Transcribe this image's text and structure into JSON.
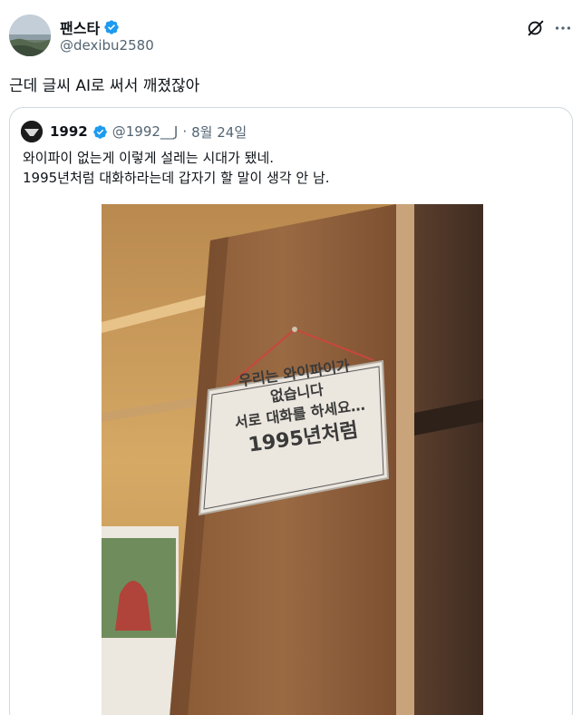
{
  "tweet": {
    "display_name": "팬스타",
    "handle": "@dexibu2580",
    "text": "근데 글씨 AI로 써서 깨졌잖아",
    "icons": {
      "verified": "verified-badge-icon",
      "grok": "grok-icon",
      "more": "more-icon"
    }
  },
  "quote": {
    "display_name": "1992",
    "handle": "@1992__J",
    "separator": "·",
    "date": "8월 24일",
    "line1": "와이파이 없는게 이렇게 설레는 시대가 됐네.",
    "line2": "1995년처럼 대화하라는데 갑자기 할 말이 생각 안 남."
  },
  "photo_sign": {
    "line1": "우리는 와이파이가",
    "line2": "없습니다",
    "line3": "서로 대화를 하세요…",
    "line4": "1995년처럼"
  },
  "colors": {
    "accent": "#1d9bf0",
    "text": "#0f1419",
    "muted": "#536471",
    "border": "#cfd9de"
  }
}
